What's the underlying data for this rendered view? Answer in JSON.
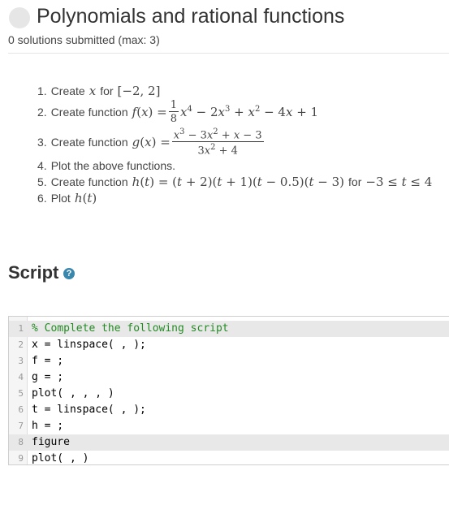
{
  "header": {
    "title": "Polynomials and rational functions",
    "submitted": "0 solutions submitted (max: 3)"
  },
  "tasks": [
    {
      "num": "1.",
      "text": "Create",
      "math": "x",
      "after": "for",
      "range": "[−2, 2]"
    },
    {
      "num": "2.",
      "text": "Create function"
    },
    {
      "num": "3.",
      "text": "Create function"
    },
    {
      "num": "4.",
      "text": "Plot the above functions."
    },
    {
      "num": "5.",
      "text": "Create function",
      "after": "for"
    },
    {
      "num": "6.",
      "text": "Plot"
    }
  ],
  "script": {
    "heading": "Script",
    "help_icon": "?",
    "lines": [
      {
        "n": "1",
        "code": "% Complete the following script"
      },
      {
        "n": "2",
        "code": "x = linspace( , );"
      },
      {
        "n": "3",
        "code": "f = ;"
      },
      {
        "n": "4",
        "code": "g = ;"
      },
      {
        "n": "5",
        "code": "plot( , , , )"
      },
      {
        "n": "6",
        "code": "t = linspace( , );"
      },
      {
        "n": "7",
        "code": "h = ;"
      },
      {
        "n": "8",
        "code": "figure"
      },
      {
        "n": "9",
        "code": "plot( , )"
      }
    ]
  }
}
